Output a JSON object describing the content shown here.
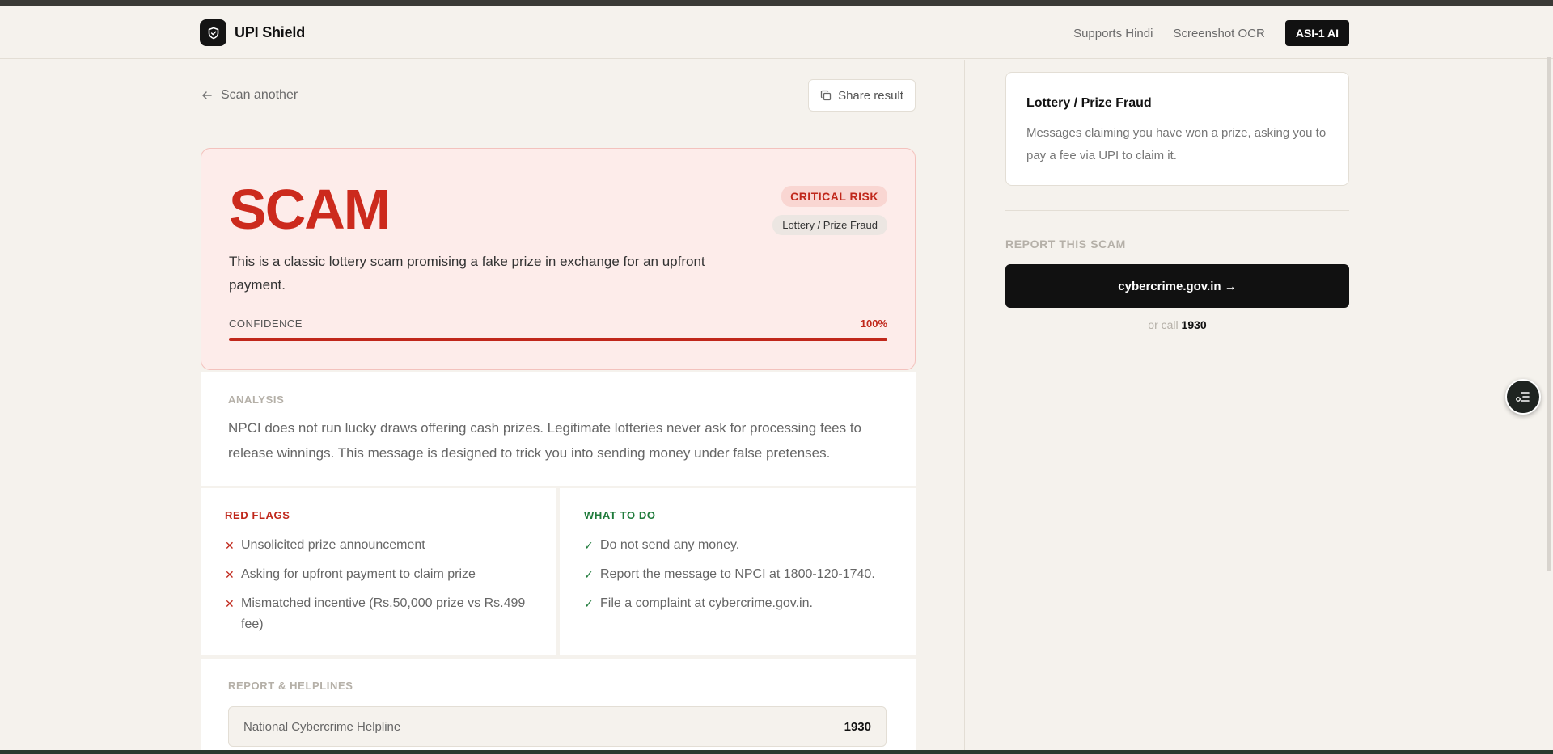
{
  "header": {
    "brand_name": "UPI Shield",
    "links": [
      "Supports Hindi",
      "Screenshot OCR"
    ],
    "badge": "ASI-1 AI"
  },
  "actions": {
    "back_label": "Scan another",
    "share_label": "Share result"
  },
  "verdict": {
    "title": "SCAM",
    "risk_label": "CRITICAL RISK",
    "category": "Lottery / Prize Fraud",
    "summary": "This is a classic lottery scam promising a fake prize in exchange for an upfront payment.",
    "confidence_label": "CONFIDENCE",
    "confidence_value": "100%",
    "confidence_fraction": 1.0
  },
  "analysis": {
    "label": "ANALYSIS",
    "text": "NPCI does not run lucky draws offering cash prizes. Legitimate lotteries never ask for processing fees to release winnings. This message is designed to trick you into sending money under false pretenses."
  },
  "red_flags": {
    "label": "RED FLAGS",
    "items": [
      "Unsolicited prize announcement",
      "Asking for upfront payment to claim prize",
      "Mismatched incentive (Rs.50,000 prize vs Rs.499 fee)"
    ]
  },
  "what_to_do": {
    "label": "WHAT TO DO",
    "items": [
      "Do not send any money.",
      "Report the message to NPCI at 1800-120-1740.",
      "File a complaint at cybercrime.gov.in."
    ]
  },
  "helplines": {
    "label": "REPORT & HELPLINES",
    "rows": [
      {
        "name": "National Cybercrime Helpline",
        "number": "1930"
      }
    ]
  },
  "sidebar": {
    "fraud_title": "Lottery / Prize Fraud",
    "fraud_desc": "Messages claiming you have won a prize, asking you to pay a fee via UPI to claim it.",
    "report_label": "REPORT THIS SCAM",
    "report_button": "cybercrime.gov.in →",
    "or_call_prefix": "or call",
    "or_call_number": "1930"
  },
  "colors": {
    "danger": "#c0271b",
    "success": "#1e7a3a",
    "background": "#f5f2ed"
  }
}
